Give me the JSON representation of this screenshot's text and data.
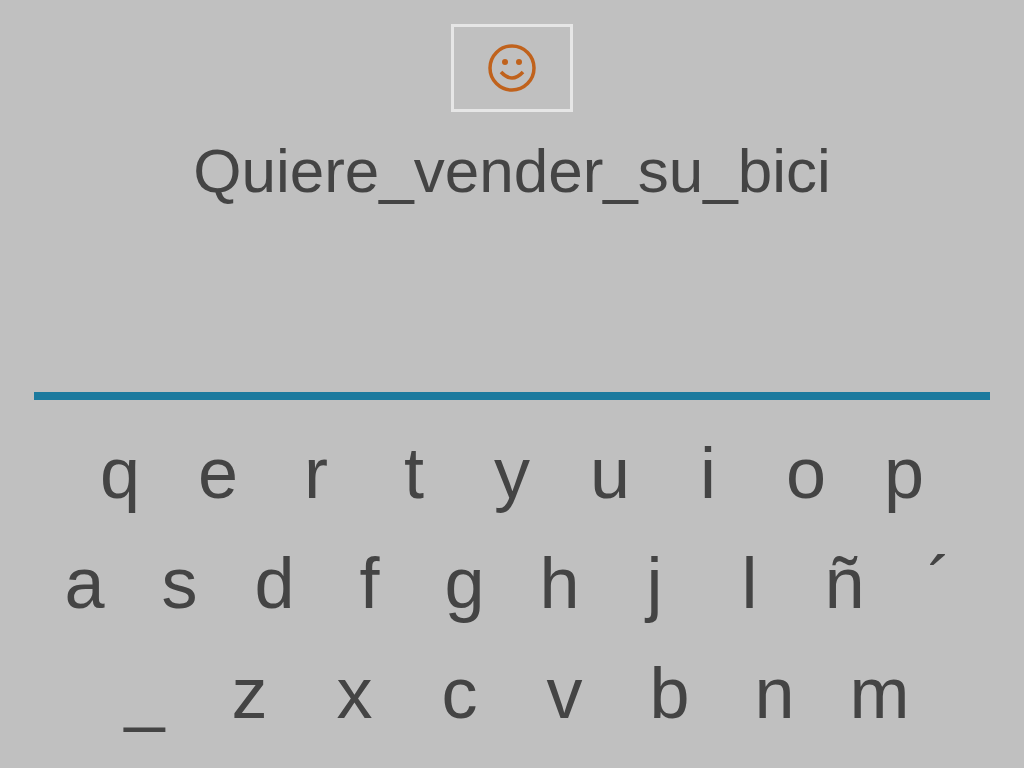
{
  "phrase": "Quiere_vender_su_bici",
  "keyboard_rows": [
    [
      "q",
      "e",
      "r",
      "t",
      "y",
      "u",
      "i",
      "o",
      "p"
    ],
    [
      "a",
      "s",
      "d",
      "f",
      "g",
      "h",
      "j",
      "l",
      "ñ",
      "´"
    ],
    [
      "_",
      "z",
      "x",
      "c",
      "v",
      "b",
      "n",
      "m"
    ]
  ]
}
